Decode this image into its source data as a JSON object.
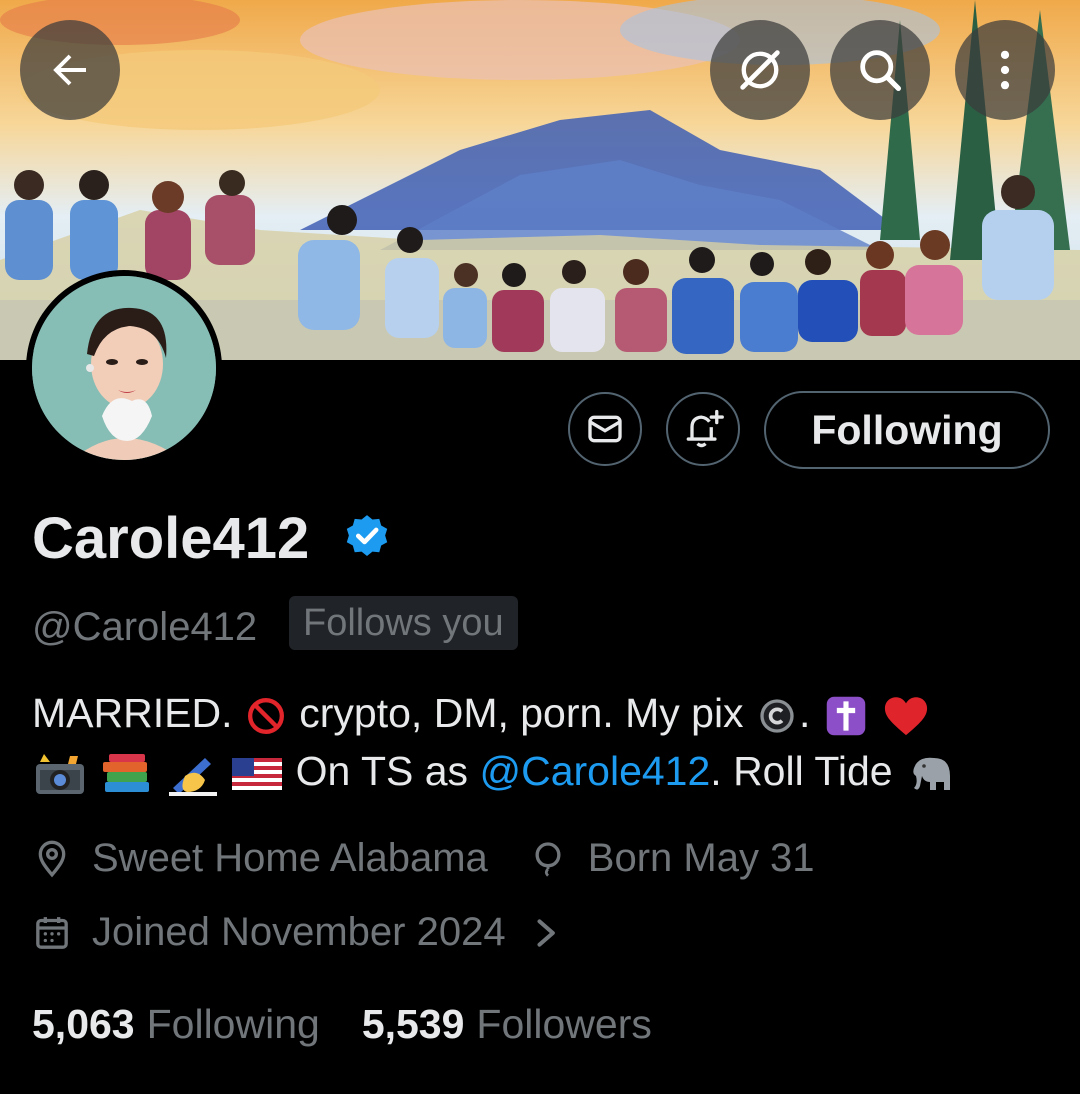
{
  "header": {
    "back_icon": "arrow-left-icon",
    "grok_icon": "grok-icon",
    "search_icon": "search-icon",
    "more_icon": "more-vertical-icon"
  },
  "profile": {
    "display_name": "Carole412",
    "verified": true,
    "handle": "@Carole412",
    "follows_you_badge": "Follows you"
  },
  "actions": {
    "message_icon": "envelope-icon",
    "notify_icon": "bell-plus-icon",
    "following_label": "Following"
  },
  "bio": {
    "line1_a": "MARRIED.",
    "line1_b": "crypto, DM, porn. My pix",
    "line1_c": ".",
    "line2_a": "On TS as",
    "line2_link": "@Carole412",
    "line2_b": ". Roll Tide",
    "emojis": [
      "prohibited",
      "copyright",
      "latin-cross",
      "red-heart",
      "camera-with-flash",
      "books",
      "writing-hand",
      "us-flag",
      "elephant"
    ]
  },
  "meta": {
    "location": "Sweet Home Alabama",
    "birthday": "Born May 31",
    "joined": "Joined November 2024"
  },
  "stats": {
    "following_count": "5,063",
    "following_label": "Following",
    "followers_count": "5,539",
    "followers_label": "Followers"
  },
  "colors": {
    "background": "#000000",
    "text_primary": "#e7e9ea",
    "text_secondary": "#71767b",
    "link": "#1d9bf0",
    "verified_badge": "#1d9bf0",
    "border": "#536471"
  }
}
